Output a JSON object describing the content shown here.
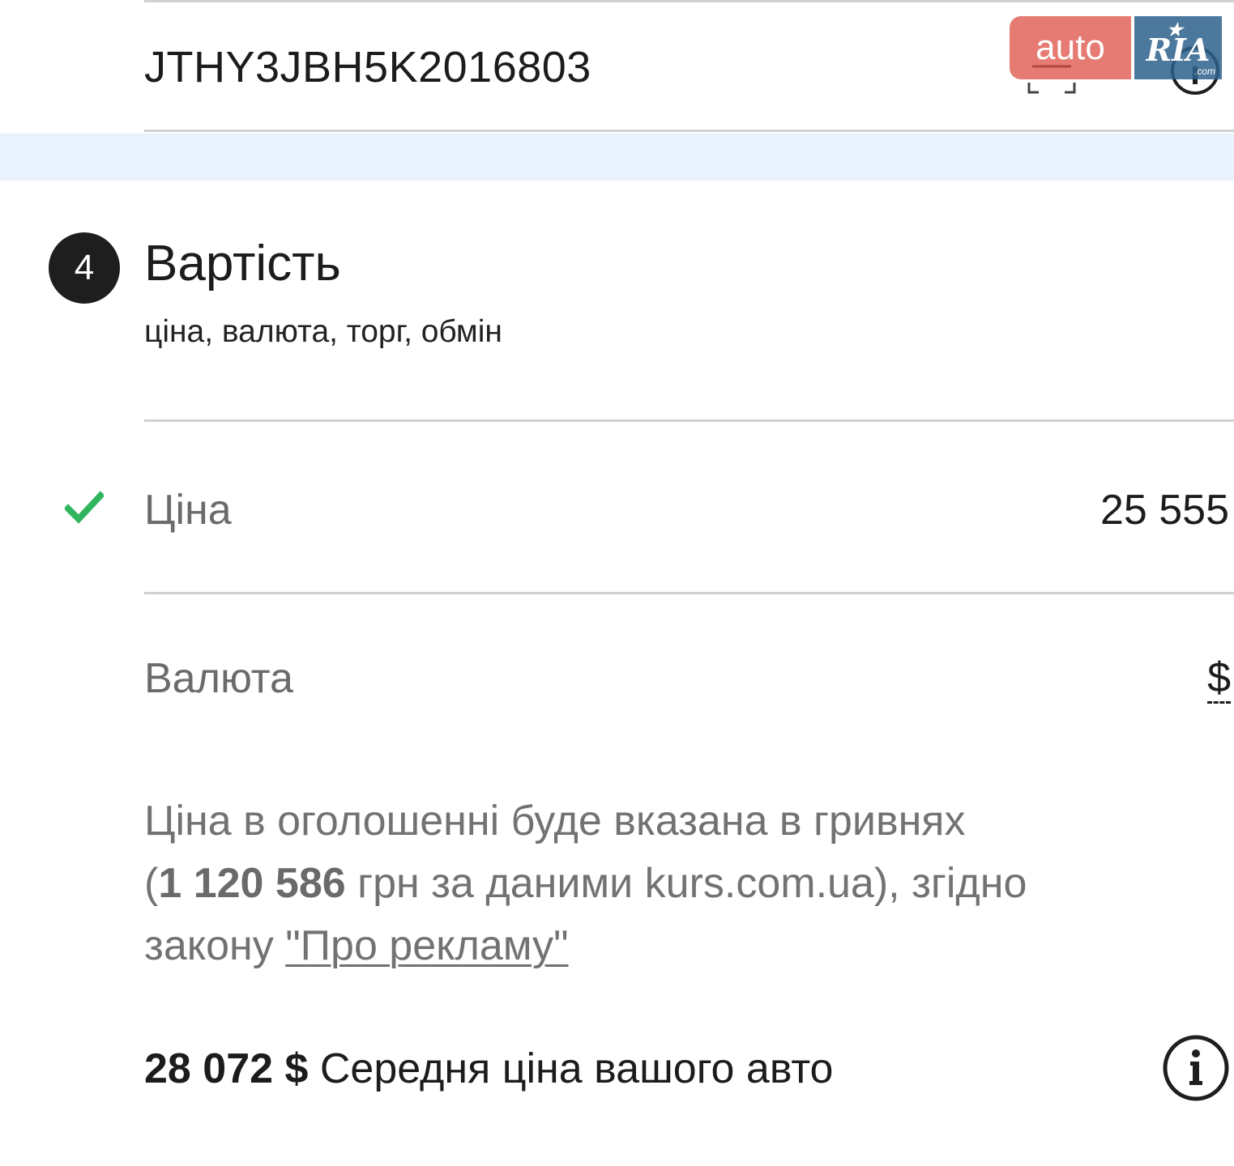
{
  "vin": {
    "value": "JTHY3JBH5K2016803"
  },
  "watermark": {
    "auto": "auto",
    "ria": "RIA",
    "com": ".com"
  },
  "section": {
    "number": "4",
    "title": "Вартість",
    "subtitle": "ціна, валюта, торг, обмін"
  },
  "price": {
    "label": "Ціна",
    "value": "25 555",
    "status": "valid"
  },
  "currency": {
    "label": "Валюта",
    "value": "$"
  },
  "notice": {
    "line1": "Ціна в оголошенні буде вказана в гривнях",
    "paren_open": "(",
    "uah_amount": "1 120 586",
    "after_amount": " грн за даними kurs.com.ua), згідно",
    "line3_prefix": "закону ",
    "law_link": "\"Про рекламу\""
  },
  "average": {
    "amount": "28 072 $",
    "label": " Середня ціна вашого авто"
  },
  "colors": {
    "check": "#2fb55e",
    "band": "#e9f2fc",
    "logo_auto": "#db483c",
    "logo_ria": "#2d608c"
  }
}
